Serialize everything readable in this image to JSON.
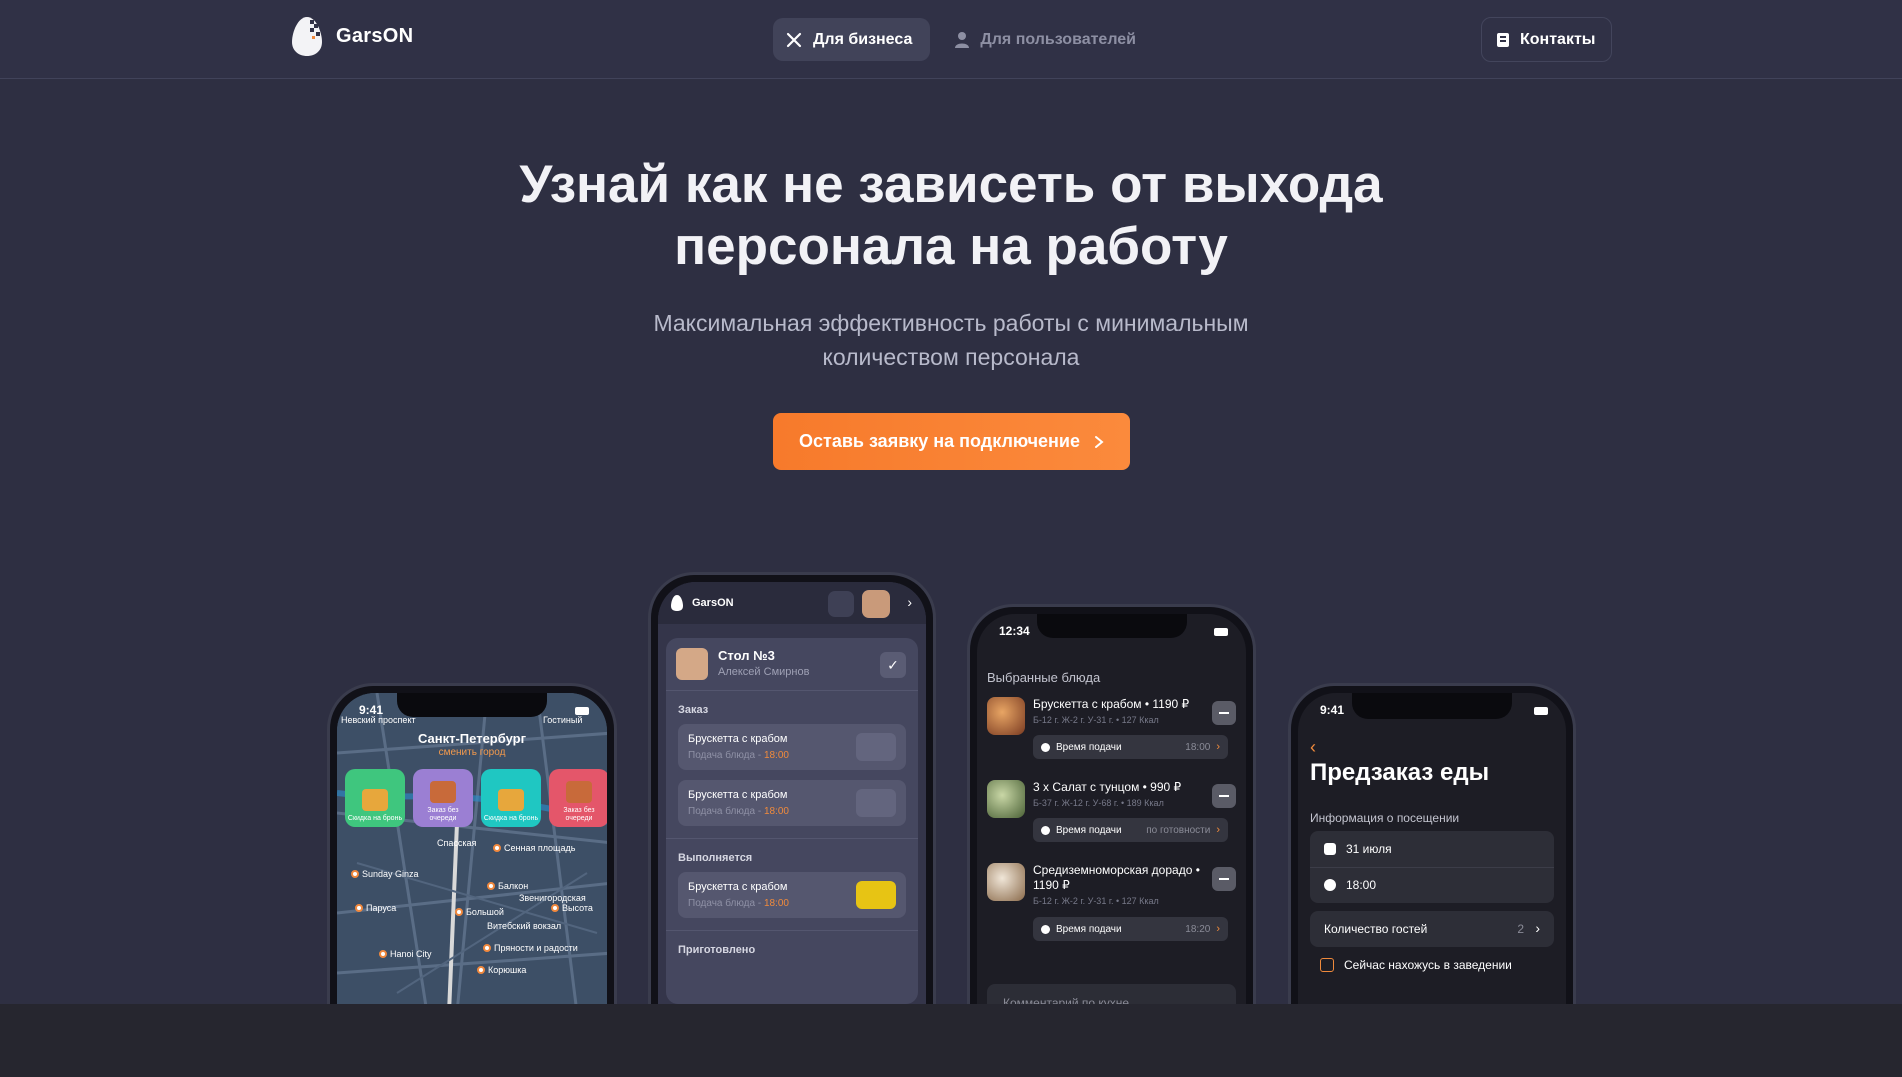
{
  "brand": {
    "name": "GarsON"
  },
  "nav": {
    "business": "Для бизнеса",
    "users": "Для пользователей",
    "contacts": "Контакты"
  },
  "hero": {
    "title_line1": "Узнай как не зависеть от выхода",
    "title_line2": "персонала на работу",
    "subtitle_line1": "Максимальная эффективность работы с минимальным",
    "subtitle_line2": "количеством персонала",
    "cta": "Оставь заявку на подключение"
  },
  "colors": {
    "accent": "#f77a2b",
    "bg": "#2e2f42",
    "footer": "#26262f"
  },
  "phone_map": {
    "time": "9:41",
    "city": "Санкт-Петербург",
    "change_city": "сменить город",
    "promos": [
      "Скидка на бронь",
      "Заказ без очереди",
      "Скидка на бронь",
      "Заказ без очереди"
    ],
    "pois": [
      "Sunday Ginza",
      "Парусa",
      "Балкон",
      "Большой",
      "Звенигородская",
      "Высота",
      "Витебский вокзал",
      "Пряности и радости",
      "Hanoi City",
      "Корюшка",
      "Сенная площадь",
      "Спасская",
      "Невский проспект",
      "Гостиный"
    ]
  },
  "phone_waiter": {
    "logo": "GarsON",
    "table": "Стол №3",
    "waiter": "Алексей Смирнов",
    "sec_order": "Заказ",
    "sec_progress": "Выполняется",
    "sec_ready": "Приготовлено",
    "items": [
      {
        "name": "Брускетта с крабом",
        "time_label": "Подача блюда -",
        "time": "18:00"
      },
      {
        "name": "Брускетта с крабом",
        "time_label": "Подача блюда -",
        "time": "18:00"
      },
      {
        "name": "Брускетта с крабом",
        "time_label": "Подача блюда -",
        "time": "18:00"
      }
    ]
  },
  "phone_dishes": {
    "time": "12:34",
    "header": "Выбранные блюда",
    "dishes": [
      {
        "name": "Брускетта с крабом • 1190 ₽",
        "meta": "Б-12 г. Ж-2 г. У-31 г. • 127 Ккал",
        "serve_label": "Время подачи",
        "serve": "18:00"
      },
      {
        "name": "3 х Салат с тунцом • 990 ₽",
        "meta": "Б-37 г. Ж-12 г. У-68 г. • 189 Ккал",
        "serve_label": "Время подачи",
        "serve": "по готовности"
      },
      {
        "name": "Средиземноморская дорадо • 1190 ₽",
        "meta": "Б-12 г. Ж-2 г. У-31 г. • 127 Ккал",
        "serve_label": "Время подачи",
        "serve": "18:20"
      }
    ],
    "comment_placeholder": "Комментарий по кухне"
  },
  "phone_preorder": {
    "time": "9:41",
    "title": "Предзаказ еды",
    "section": "Информация о посещении",
    "date": "31 июля",
    "time_value": "18:00",
    "guests_label": "Количество гостей",
    "guests": "2",
    "here": "Сейчас нахожусь в заведении"
  }
}
